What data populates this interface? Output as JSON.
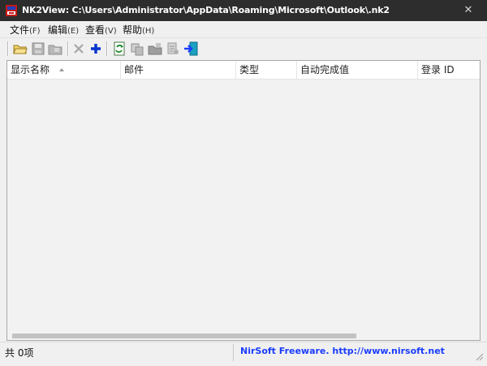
{
  "window": {
    "title": "NK2View:  C:\\Users\\Administrator\\AppData\\Roaming\\Microsoft\\Outlook\\.nk2",
    "close_symbol": "✕"
  },
  "menu": [
    {
      "label": "文件",
      "accel": "(F)"
    },
    {
      "label": "编辑",
      "accel": "(E)"
    },
    {
      "label": "查看",
      "accel": "(V)"
    },
    {
      "label": "帮助",
      "accel": "(H)"
    }
  ],
  "toolbar": {
    "icons": [
      "open-folder-icon",
      "save-icon",
      "folder-icon",
      "delete-icon",
      "add-icon",
      "refresh-icon",
      "copy-icon",
      "folder-export-icon",
      "properties-icon",
      "exit-icon"
    ],
    "accent_add": "#0033cc",
    "accent_exit": "#1aa0c0"
  },
  "list": {
    "columns": [
      {
        "label": "显示名称",
        "sorted": true
      },
      {
        "label": "邮件"
      },
      {
        "label": "类型"
      },
      {
        "label": "自动完成值"
      },
      {
        "label": "登录 ID"
      }
    ],
    "rows": []
  },
  "status": {
    "count": "共 0项",
    "link": "NirSoft Freeware.  http://www.nirsoft.net",
    "link_color": "#1a3cff"
  }
}
